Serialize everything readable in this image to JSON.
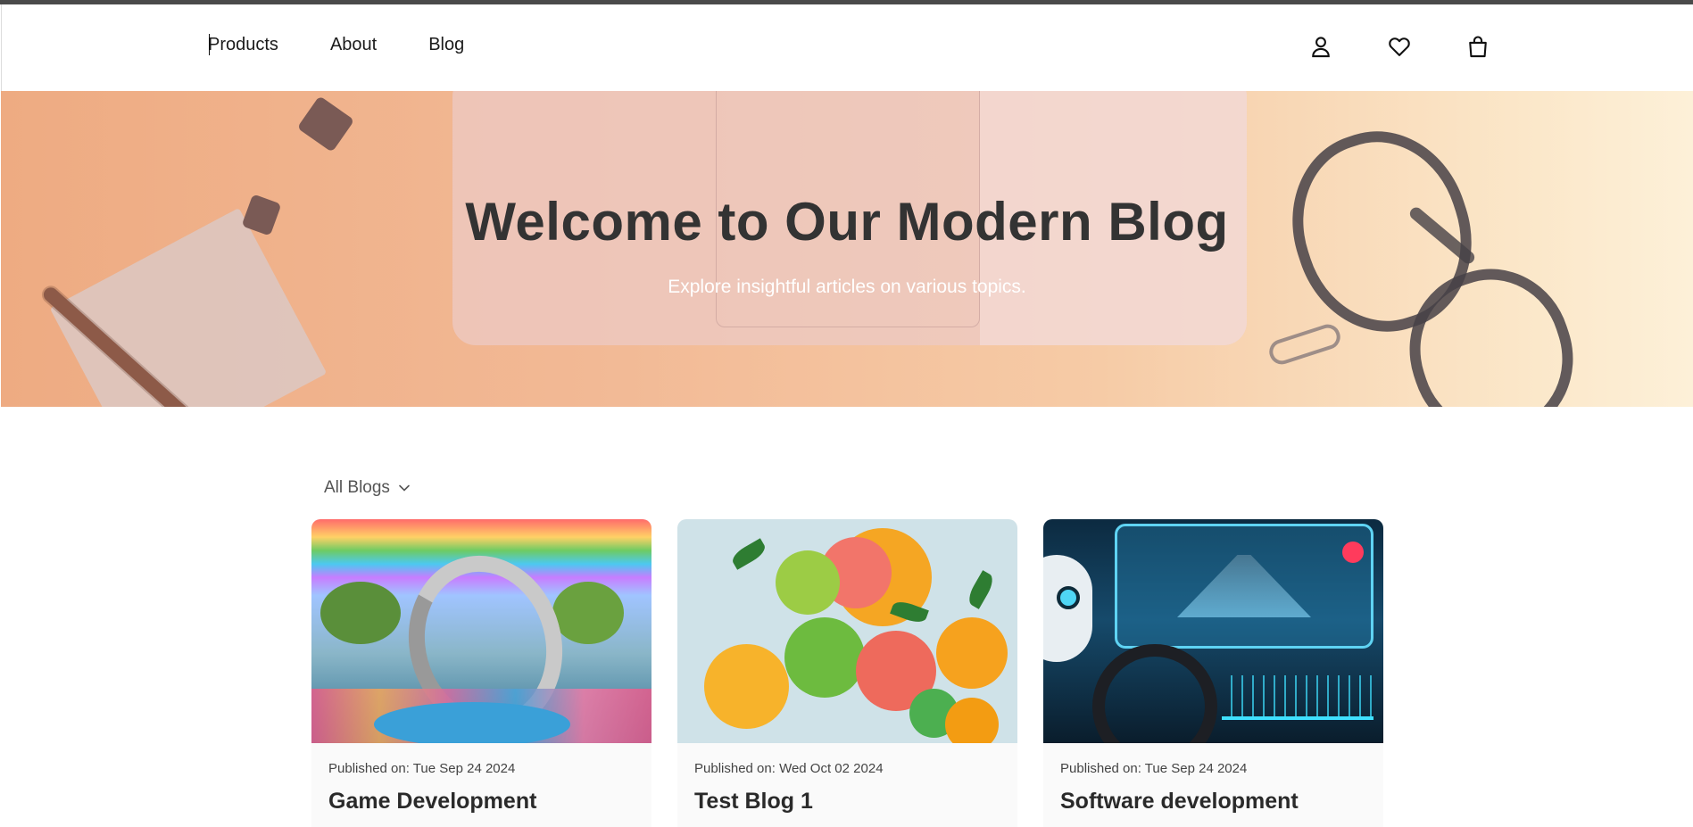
{
  "nav": {
    "items": [
      {
        "label": "Products"
      },
      {
        "label": "About"
      },
      {
        "label": "Blog"
      }
    ]
  },
  "header_icons": [
    "user-icon",
    "heart-icon",
    "shopping-bag-icon"
  ],
  "hero": {
    "title": "Welcome to Our Modern Blog",
    "subtitle": "Explore insightful articles on various topics."
  },
  "filter": {
    "label": "All Blogs",
    "icon": "chevron-down-icon"
  },
  "cards": [
    {
      "published": "Published on: Tue Sep 24 2024",
      "title": "Game Development"
    },
    {
      "published": "Published on: Wed Oct 02 2024",
      "title": "Test Blog 1"
    },
    {
      "published": "Published on: Tue Sep 24 2024",
      "title": "Software development"
    }
  ],
  "colors": {
    "hero_start": "#eeab82",
    "hero_end": "#fdf0d8",
    "title_text": "#333333",
    "subtitle_text": "#ffffff"
  }
}
